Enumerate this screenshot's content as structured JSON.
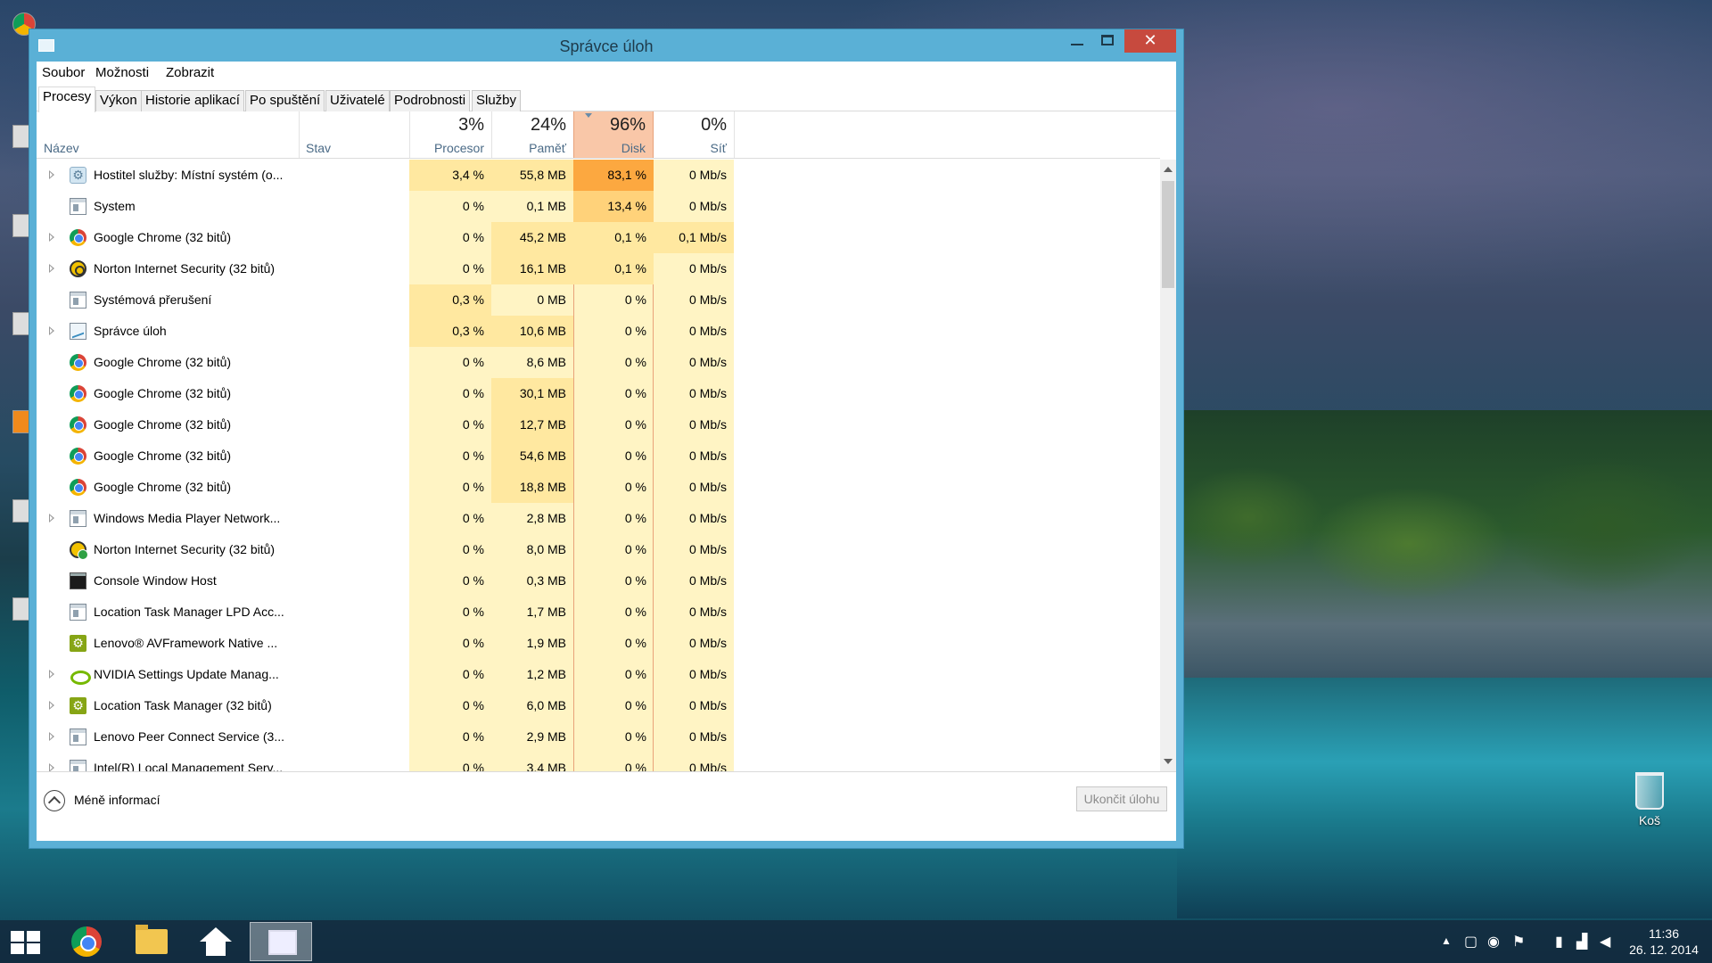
{
  "window": {
    "title": "Správce úloh",
    "close_glyph": "✕"
  },
  "menu": [
    "Soubor",
    "Možnosti",
    "Zobrazit"
  ],
  "tabs": [
    "Procesy",
    "Výkon",
    "Historie aplikací",
    "Po spuštění",
    "Uživatelé",
    "Podrobnosti",
    "Služby"
  ],
  "active_tab": "Procesy",
  "columns": {
    "name": "Název",
    "status": "Stav",
    "cpu": {
      "pct": "3%",
      "label": "Procesor"
    },
    "mem": {
      "pct": "24%",
      "label": "Paměť"
    },
    "disk": {
      "pct": "96%",
      "label": "Disk"
    },
    "net": {
      "pct": "0%",
      "label": "Síť"
    }
  },
  "processes": [
    {
      "name": "Hostitel služby: Místní systém (o...",
      "icon": "gear-icon",
      "expand": true,
      "cpu": "3,4 %",
      "mem": "55,8 MB",
      "disk": "83,1 %",
      "net": "0 Mb/s"
    },
    {
      "name": "System",
      "icon": "window-icon",
      "expand": false,
      "cpu": "0 %",
      "mem": "0,1 MB",
      "disk": "13,4 %",
      "net": "0 Mb/s"
    },
    {
      "name": "Google Chrome (32 bitů)",
      "icon": "chrome-icon",
      "expand": true,
      "cpu": "0 %",
      "mem": "45,2 MB",
      "disk": "0,1 %",
      "net": "0,1 Mb/s"
    },
    {
      "name": "Norton Internet Security (32 bitů)",
      "icon": "norton-icon",
      "expand": true,
      "cpu": "0 %",
      "mem": "16,1 MB",
      "disk": "0,1 %",
      "net": "0 Mb/s"
    },
    {
      "name": "Systémová přerušení",
      "icon": "window-icon",
      "expand": false,
      "cpu": "0,3 %",
      "mem": "0 MB",
      "disk": "0 %",
      "net": "0 Mb/s"
    },
    {
      "name": "Správce úloh",
      "icon": "task-manager-icon",
      "expand": true,
      "cpu": "0,3 %",
      "mem": "10,6 MB",
      "disk": "0 %",
      "net": "0 Mb/s"
    },
    {
      "name": "Google Chrome (32 bitů)",
      "icon": "chrome-icon",
      "expand": false,
      "cpu": "0 %",
      "mem": "8,6 MB",
      "disk": "0 %",
      "net": "0 Mb/s"
    },
    {
      "name": "Google Chrome (32 bitů)",
      "icon": "chrome-icon",
      "expand": false,
      "cpu": "0 %",
      "mem": "30,1 MB",
      "disk": "0 %",
      "net": "0 Mb/s"
    },
    {
      "name": "Google Chrome (32 bitů)",
      "icon": "chrome-icon",
      "expand": false,
      "cpu": "0 %",
      "mem": "12,7 MB",
      "disk": "0 %",
      "net": "0 Mb/s"
    },
    {
      "name": "Google Chrome (32 bitů)",
      "icon": "chrome-icon",
      "expand": false,
      "cpu": "0 %",
      "mem": "54,6 MB",
      "disk": "0 %",
      "net": "0 Mb/s"
    },
    {
      "name": "Google Chrome (32 bitů)",
      "icon": "chrome-icon",
      "expand": false,
      "cpu": "0 %",
      "mem": "18,8 MB",
      "disk": "0 %",
      "net": "0 Mb/s"
    },
    {
      "name": "Windows Media Player Network...",
      "icon": "window-icon",
      "expand": true,
      "cpu": "0 %",
      "mem": "2,8 MB",
      "disk": "0 %",
      "net": "0 Mb/s"
    },
    {
      "name": "Norton Internet Security (32 bitů)",
      "icon": "norton-shield-icon",
      "expand": false,
      "cpu": "0 %",
      "mem": "8,0 MB",
      "disk": "0 %",
      "net": "0 Mb/s"
    },
    {
      "name": "Console Window Host",
      "icon": "console-icon",
      "expand": false,
      "cpu": "0 %",
      "mem": "0,3 MB",
      "disk": "0 %",
      "net": "0 Mb/s"
    },
    {
      "name": "Location Task Manager LPD Acc...",
      "icon": "window-icon",
      "expand": false,
      "cpu": "0 %",
      "mem": "1,7 MB",
      "disk": "0 %",
      "net": "0 Mb/s"
    },
    {
      "name": "Lenovo® AVFramework Native ...",
      "icon": "lenovo-gear-icon",
      "expand": false,
      "cpu": "0 %",
      "mem": "1,9 MB",
      "disk": "0 %",
      "net": "0 Mb/s"
    },
    {
      "name": "NVIDIA Settings Update Manag...",
      "icon": "nvidia-icon",
      "expand": true,
      "cpu": "0 %",
      "mem": "1,2 MB",
      "disk": "0 %",
      "net": "0 Mb/s"
    },
    {
      "name": "Location Task Manager (32 bitů)",
      "icon": "lenovo-gear-icon",
      "expand": true,
      "cpu": "0 %",
      "mem": "6,0 MB",
      "disk": "0 %",
      "net": "0 Mb/s"
    },
    {
      "name": "Lenovo Peer Connect Service (3...",
      "icon": "window-icon",
      "expand": true,
      "cpu": "0 %",
      "mem": "2,9 MB",
      "disk": "0 %",
      "net": "0 Mb/s"
    },
    {
      "name": "Intel(R) Local Management Serv...",
      "icon": "window-icon",
      "expand": true,
      "cpu": "0 %",
      "mem": "3,4 MB",
      "disk": "0 %",
      "net": "0 Mb/s"
    }
  ],
  "footer": {
    "less_info": "Méně informací",
    "end_task": "Ukončit úlohu"
  },
  "desktop": {
    "recycle_bin": "Koš"
  },
  "taskbar": {
    "time": "11:36",
    "date": "26. 12. 2014"
  },
  "colors": {
    "heat_light": "#fff4c4",
    "heat_mid": "#ffe8a0",
    "heat_high": "#ffd27a",
    "heat_max": "#fca840",
    "disk_header": "#f9c7a8",
    "window_frame": "#5ab0d6"
  }
}
